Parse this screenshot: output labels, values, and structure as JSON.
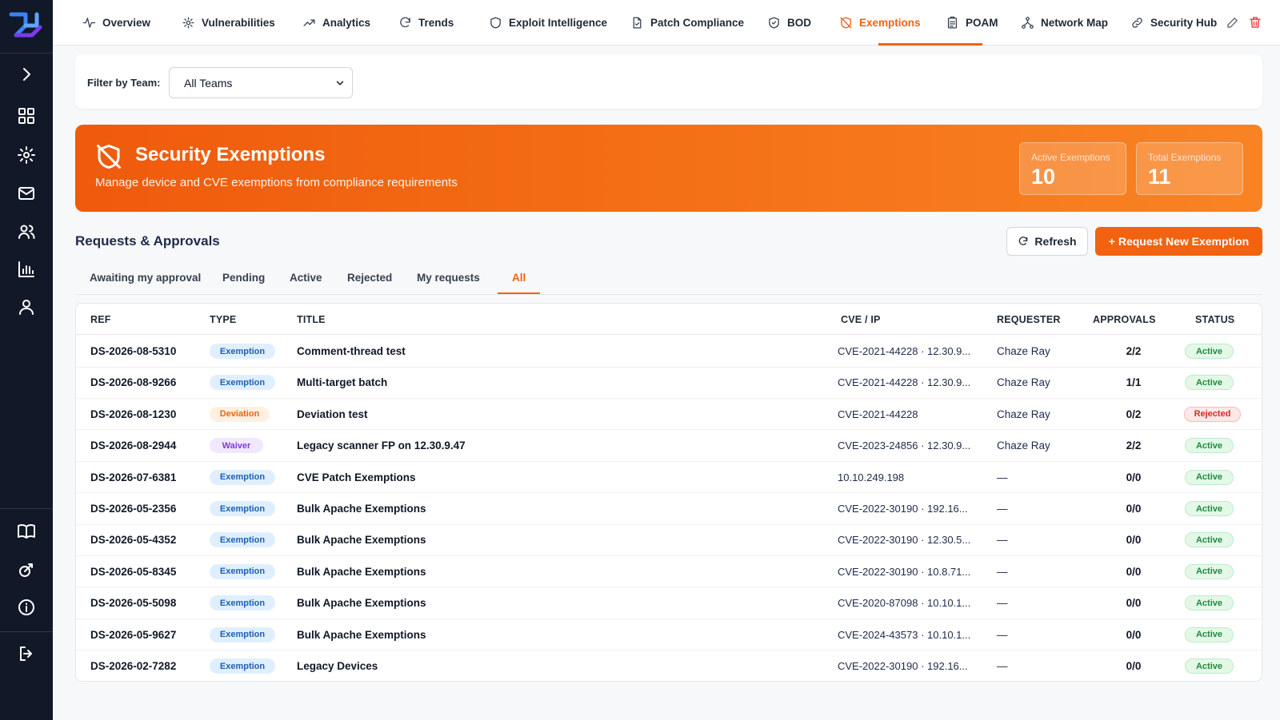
{
  "colors": {
    "accent": "#f2620f",
    "sidebar": "#111827",
    "active_status": "#1f8a3b",
    "rejected_status": "#d42a2a"
  },
  "sidebar": {
    "logo": "brand-logo",
    "icons": [
      "chevron-right-icon",
      "grid-icon",
      "settings-icon",
      "mail-icon",
      "users-icon",
      "bar-chart-icon",
      "user-icon",
      "book-icon",
      "satellite-icon",
      "info-icon",
      "logout-icon"
    ]
  },
  "nav": {
    "tabs": [
      {
        "label": "Overview",
        "icon": "activity-icon"
      },
      {
        "label": "Vulnerabilities",
        "icon": "bug-icon"
      },
      {
        "label": "Analytics",
        "icon": "trending-up-icon"
      },
      {
        "label": "Trends",
        "icon": "refresh-icon"
      },
      {
        "label": "Exploit Intelligence",
        "icon": "shield-icon"
      },
      {
        "label": "Patch Compliance",
        "icon": "file-check-icon"
      },
      {
        "label": "BOD",
        "icon": "shield-check-icon"
      },
      {
        "label": "Exemptions",
        "icon": "shield-off-icon"
      },
      {
        "label": "POAM",
        "icon": "clipboard-icon"
      },
      {
        "label": "Network Map",
        "icon": "network-icon"
      },
      {
        "label": "Security Hub",
        "icon": "link-icon"
      }
    ],
    "active": "Exemptions"
  },
  "filter": {
    "label": "Filter by Team:",
    "selected": "All Teams"
  },
  "banner": {
    "title": "Security Exemptions",
    "subtitle": "Manage device and CVE exemptions from compliance requirements",
    "stats": [
      {
        "label": "Active Exemptions",
        "value": "10"
      },
      {
        "label": "Total Exemptions",
        "value": "11"
      }
    ]
  },
  "requests": {
    "title": "Requests & Approvals",
    "refresh_label": "Refresh",
    "new_label": "+ Request New Exemption",
    "tabs": [
      "Awaiting my approval",
      "Pending",
      "Active",
      "Rejected",
      "My requests",
      "All"
    ],
    "active_tab": "All"
  },
  "table": {
    "columns": [
      "REF",
      "TYPE",
      "TITLE",
      "CVE / IP",
      "REQUESTER",
      "APPROVALS",
      "STATUS"
    ],
    "rows": [
      {
        "ref": "DS-2026-08-5310",
        "type": "Exemption",
        "title": "Comment-thread test",
        "cve": "CVE-2021-44228 · 12.30.9...",
        "requester": "Chaze Ray",
        "approvals": "2/2",
        "status": "Active"
      },
      {
        "ref": "DS-2026-08-9266",
        "type": "Exemption",
        "title": "Multi-target batch",
        "cve": "CVE-2021-44228 · 12.30.9...",
        "requester": "Chaze Ray",
        "approvals": "1/1",
        "status": "Active"
      },
      {
        "ref": "DS-2026-08-1230",
        "type": "Deviation",
        "title": "Deviation test",
        "cve": "CVE-2021-44228",
        "requester": "Chaze Ray",
        "approvals": "0/2",
        "status": "Rejected"
      },
      {
        "ref": "DS-2026-08-2944",
        "type": "Waiver",
        "title": "Legacy scanner FP on 12.30.9.47",
        "cve": "CVE-2023-24856 · 12.30.9...",
        "requester": "Chaze Ray",
        "approvals": "2/2",
        "status": "Active"
      },
      {
        "ref": "DS-2026-07-6381",
        "type": "Exemption",
        "title": "CVE Patch Exemptions",
        "cve": "10.10.249.198",
        "requester": "—",
        "approvals": "0/0",
        "status": "Active"
      },
      {
        "ref": "DS-2026-05-2356",
        "type": "Exemption",
        "title": "Bulk Apache Exemptions",
        "cve": "CVE-2022-30190 · 192.16...",
        "requester": "—",
        "approvals": "0/0",
        "status": "Active"
      },
      {
        "ref": "DS-2026-05-4352",
        "type": "Exemption",
        "title": "Bulk Apache Exemptions",
        "cve": "CVE-2022-30190 · 12.30.5...",
        "requester": "—",
        "approvals": "0/0",
        "status": "Active"
      },
      {
        "ref": "DS-2026-05-8345",
        "type": "Exemption",
        "title": "Bulk Apache Exemptions",
        "cve": "CVE-2022-30190 · 10.8.71...",
        "requester": "—",
        "approvals": "0/0",
        "status": "Active"
      },
      {
        "ref": "DS-2026-05-5098",
        "type": "Exemption",
        "title": "Bulk Apache Exemptions",
        "cve": "CVE-2020-87098 · 10.10.1...",
        "requester": "—",
        "approvals": "0/0",
        "status": "Active"
      },
      {
        "ref": "DS-2026-05-9627",
        "type": "Exemption",
        "title": "Bulk Apache Exemptions",
        "cve": "CVE-2024-43573 · 10.10.1...",
        "requester": "—",
        "approvals": "0/0",
        "status": "Active"
      },
      {
        "ref": "DS-2026-02-7282",
        "type": "Exemption",
        "title": "Legacy Devices",
        "cve": "CVE-2022-30190 · 192.16...",
        "requester": "—",
        "approvals": "0/0",
        "status": "Active"
      }
    ]
  }
}
